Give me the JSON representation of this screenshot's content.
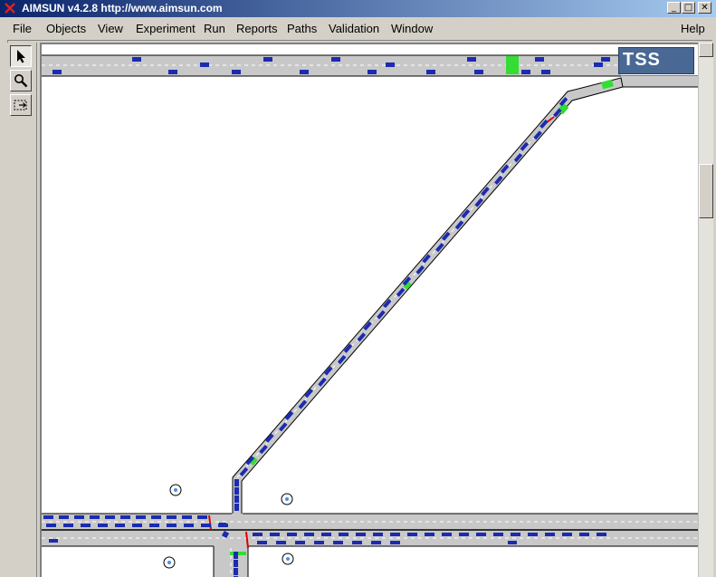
{
  "window": {
    "title": "AIMSUN v4.2.8 http://www.aimsun.com",
    "icon": "aimsun-x-icon",
    "controls": {
      "minimize": "_",
      "maximize": "□",
      "close": "✕"
    }
  },
  "menu": {
    "items": [
      "File",
      "Objects",
      "View",
      "Experiment",
      "Run",
      "Reports",
      "Paths",
      "Validation",
      "Window"
    ],
    "help": "Help"
  },
  "toolbox": {
    "tools": [
      "pointer-icon",
      "zoom-magnifier-icon",
      "region-select-icon"
    ],
    "active": "pointer-icon"
  },
  "canvas": {
    "logo": "TSS",
    "colors": {
      "road": "#c8c8c8",
      "road_edge": "#000000",
      "lane_marking": "#ffffff",
      "vehicle": "#1c2bb0",
      "detector": "#33dd33",
      "signal_stop": "#dd0000",
      "background": "#ffffff"
    }
  }
}
